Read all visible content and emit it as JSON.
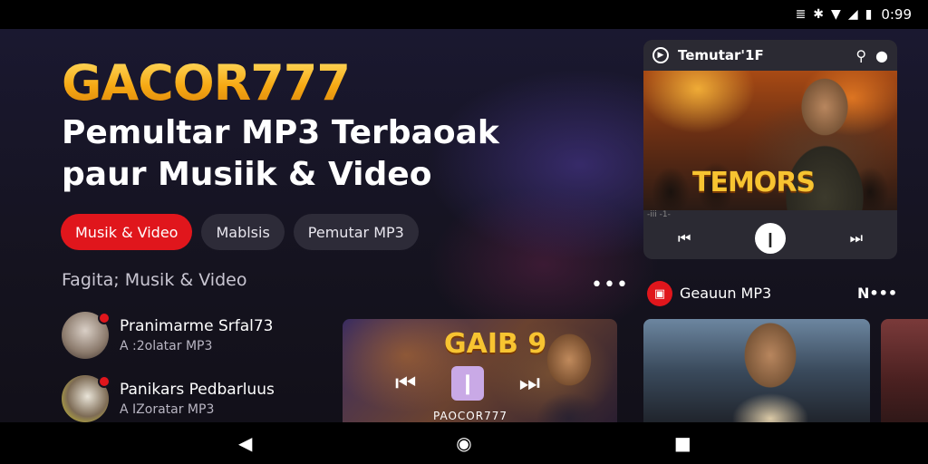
{
  "status_bar": {
    "time": "0:99",
    "icons": [
      "vibrate-icon",
      "bluetooth-icon",
      "wifi-icon",
      "signal-icon",
      "battery-icon"
    ]
  },
  "hero": {
    "brand": "GACOR777",
    "headline_line1": "Pemultar MP3 Terbaoak",
    "headline_line2": "paur Musiik & Video"
  },
  "chips": [
    {
      "label": "Musik & Video",
      "active": true
    },
    {
      "label": "Mablsis",
      "active": false
    },
    {
      "label": "Pemutar MP3",
      "active": false
    }
  ],
  "section": {
    "title": "Fagita; Musik & Video",
    "more": "•••"
  },
  "list": [
    {
      "title": "Pranimarme Srfal73",
      "subtitle": "A :2olatar MP3"
    },
    {
      "title": "Panikars Pedbarluus",
      "subtitle": "A IZoratar MP3"
    }
  ],
  "player_card": {
    "title": "Temutar'1F",
    "banner": "TEMORS",
    "small_text": "-iii -1-"
  },
  "recommend": {
    "title": "Geauun MP3",
    "more": "N•••"
  },
  "video_card": {
    "title": "GAIB 9",
    "caption": "PAOCOR777"
  },
  "colors": {
    "accent": "#e0161c",
    "brand_gold": "#f7b21c",
    "background": "#14121f",
    "chip_bg": "#2d2b38"
  }
}
